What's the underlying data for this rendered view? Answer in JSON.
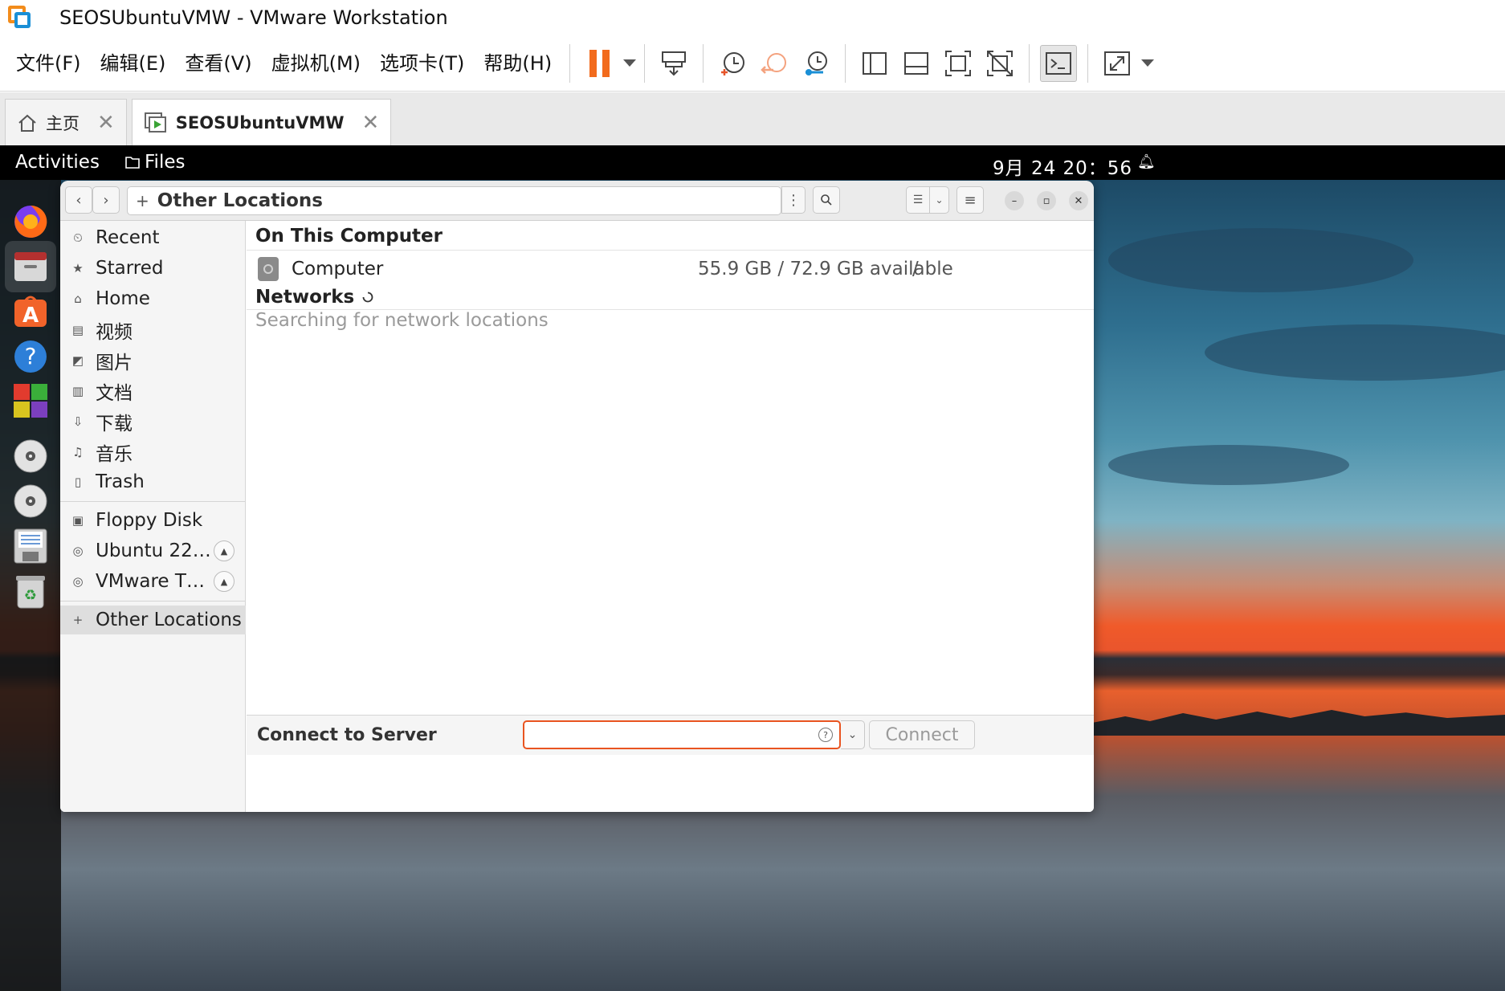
{
  "vmware": {
    "window_title": "SEOSUbuntuVMW - VMware Workstation",
    "menu": [
      "文件(F)",
      "编辑(E)",
      "查看(V)",
      "虚拟机(M)",
      "选项卡(T)",
      "帮助(H)"
    ],
    "tabs": [
      {
        "label": "主页",
        "icon": "home-icon"
      },
      {
        "label": "SEOSUbuntuVMW",
        "icon": "vm-running-icon"
      }
    ],
    "accent_color": "#f26b1d"
  },
  "ubuntu": {
    "topbar": {
      "activities": "Activities",
      "app_name": "Files",
      "clock": "9月 24  20：56"
    },
    "dock": [
      "firefox-icon",
      "files-icon",
      "app-center-icon",
      "help-icon",
      "app-grid-icon",
      "cd-drive-icon",
      "cd-drive-icon",
      "floppy-icon",
      "trash-icon"
    ]
  },
  "nautilus": {
    "location": "Other Locations",
    "sidebar": {
      "places": [
        {
          "label": "Recent",
          "icon": "⏲"
        },
        {
          "label": "Starred",
          "icon": "★"
        },
        {
          "label": "Home",
          "icon": "⌂"
        },
        {
          "label": "视频",
          "icon": "▤"
        },
        {
          "label": "图片",
          "icon": "◩"
        },
        {
          "label": "文档",
          "icon": "▥"
        },
        {
          "label": "下载",
          "icon": "⇩"
        },
        {
          "label": "音乐",
          "icon": "♫"
        },
        {
          "label": "Trash",
          "icon": "▯"
        }
      ],
      "devices": [
        {
          "label": "Floppy Disk",
          "icon": "▣",
          "eject": false
        },
        {
          "label": "Ubuntu 22…",
          "icon": "◎",
          "eject": true
        },
        {
          "label": "VMware T…",
          "icon": "◎",
          "eject": true
        }
      ],
      "other_locations": "Other Locations"
    },
    "main": {
      "on_this_computer": "On This Computer",
      "computer_name": "Computer",
      "computer_space": "55.9 GB / 72.9 GB available",
      "computer_mount": "/",
      "networks": "Networks",
      "network_status": "Searching for network locations"
    },
    "connect": {
      "label": "Connect to Server",
      "input_value": "",
      "button": "Connect"
    }
  }
}
